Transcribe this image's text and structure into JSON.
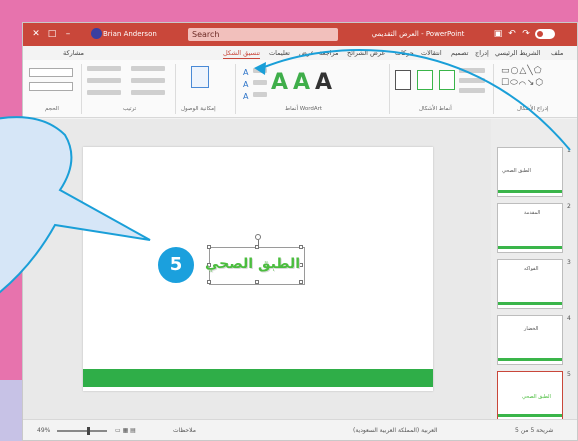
{
  "titlebar": {
    "search_text": "Search",
    "doc_title": "العرض التقديمي - PowerPoint",
    "user_name": "Brian Anderson"
  },
  "tabs": [
    {
      "label": "ملف",
      "active": false
    },
    {
      "label": "الشريط الرئيسي",
      "active": false
    },
    {
      "label": "إدراج",
      "active": false
    },
    {
      "label": "تصميم",
      "active": false
    },
    {
      "label": "انتقالات",
      "active": false
    },
    {
      "label": "حركات",
      "active": false
    },
    {
      "label": "عرض الشرائح",
      "active": false
    },
    {
      "label": "مراجعة",
      "active": false
    },
    {
      "label": "عرض",
      "active": false
    },
    {
      "label": "تعليمات",
      "active": false
    },
    {
      "label": "تنسيق الشكل",
      "active": true
    },
    {
      "label": "مشاركة",
      "active": false
    }
  ],
  "ribbon": {
    "groups": [
      "إدراج الأشكال",
      "أنماط الأشكال",
      "أنماط WordArt",
      "إمكانية الوصول",
      "ترتيب",
      "الحجم"
    ],
    "wordart_letters": [
      "A",
      "A",
      "A"
    ],
    "wordart_colors": [
      "#3fae4a",
      "#3fae4a",
      "#333333"
    ]
  },
  "slide": {
    "title_text": "الطبق الصحي",
    "step_number": "5"
  },
  "thumbnails": [
    {
      "num": "1",
      "text": "الطبق الصحي"
    },
    {
      "num": "2",
      "text": "المقدمة"
    },
    {
      "num": "3",
      "text": "الفواكه"
    },
    {
      "num": "4",
      "text": "الخضار"
    },
    {
      "num": "5",
      "text": "الطبق الصحي"
    }
  ],
  "statusbar": {
    "slide_info": "شريحة 5 من 5",
    "language": "العربية (المملكة العربية السعودية)",
    "notes": "ملاحظات",
    "zoom": "49%"
  },
  "colors": {
    "accent": "#c9473a",
    "wordart_green": "#4bbd3e",
    "badge_blue": "#1ba0dd",
    "bubble_fill": "#d6e6f7"
  }
}
